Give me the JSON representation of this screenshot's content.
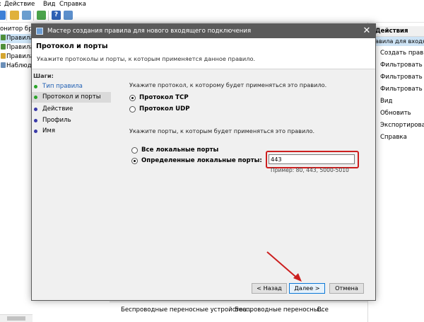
{
  "menu": {
    "items": [
      "Действие",
      "Вид",
      "Справка"
    ]
  },
  "tree": {
    "items": [
      {
        "label": "онитор бра",
        "selected": false
      },
      {
        "label": "Правила д",
        "selected": true
      },
      {
        "label": "Правила д",
        "selected": false
      },
      {
        "label": "Правила б",
        "selected": false
      },
      {
        "label": "Наблюден",
        "selected": false
      }
    ]
  },
  "actions": {
    "header": "Действия",
    "subheader": "авила для входящ",
    "items": [
      "Создать правило...",
      "Фильтровать по п",
      "Фильтровать по с",
      "Фильтровать по г",
      "Вид",
      "Обновить",
      "Экспортировать с",
      "Справка"
    ]
  },
  "bottom_row": [
    "Беспроводные переносные устройства...",
    "Беспроводные переносны...",
    "Все"
  ],
  "dialog": {
    "title": "Мастер создания правила для нового входящего подключения",
    "header_title": "Протокол и порты",
    "header_subtitle": "Укажите протоколы и порты, к которым применяется данное правило.",
    "steps_label": "Шаги:",
    "steps": [
      {
        "label": "Тип правила",
        "state": "done"
      },
      {
        "label": "Протокол и порты",
        "state": "active"
      },
      {
        "label": "Действие",
        "state": "todo"
      },
      {
        "label": "Профиль",
        "state": "todo"
      },
      {
        "label": "Имя",
        "state": "todo"
      }
    ],
    "protocol_question": "Укажите протокол, к которому будет применяться это правило.",
    "protocol_options": [
      {
        "label": "Протокол TCP",
        "selected": true
      },
      {
        "label": "Протокол UDP",
        "selected": false
      }
    ],
    "ports_question": "Укажите порты, к которым будет применяться это правило.",
    "port_options": [
      {
        "label": "Все локальные порты",
        "selected": false
      },
      {
        "label": "Определенные локальные порты:",
        "selected": true
      }
    ],
    "port_value": "443",
    "port_example": "Пример: 80, 443, 5000-5010",
    "buttons": {
      "back": "< Назад",
      "next": "Далее >",
      "cancel": "Отмена"
    }
  },
  "colors": {
    "highlight": "#cc1f1f",
    "title_bar": "#5a5a5a",
    "accent_blue": "#0b78d7"
  }
}
